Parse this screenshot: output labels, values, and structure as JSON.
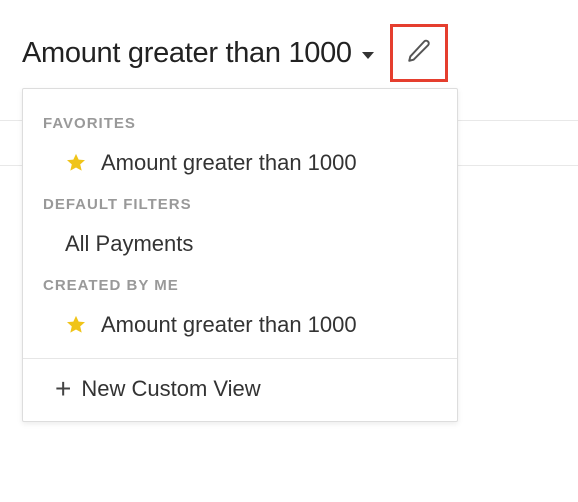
{
  "header": {
    "view_title": "Amount greater than 1000"
  },
  "dropdown": {
    "sections": {
      "favorites": {
        "label": "FAVORITES",
        "items": [
          {
            "label": "Amount greater than 1000",
            "starred": true
          }
        ]
      },
      "default_filters": {
        "label": "DEFAULT FILTERS",
        "items": [
          {
            "label": "All Payments",
            "starred": false
          }
        ]
      },
      "created_by_me": {
        "label": "CREATED BY ME",
        "items": [
          {
            "label": "Amount greater than 1000",
            "starred": true
          }
        ]
      }
    },
    "new_view_label": "New Custom View"
  }
}
